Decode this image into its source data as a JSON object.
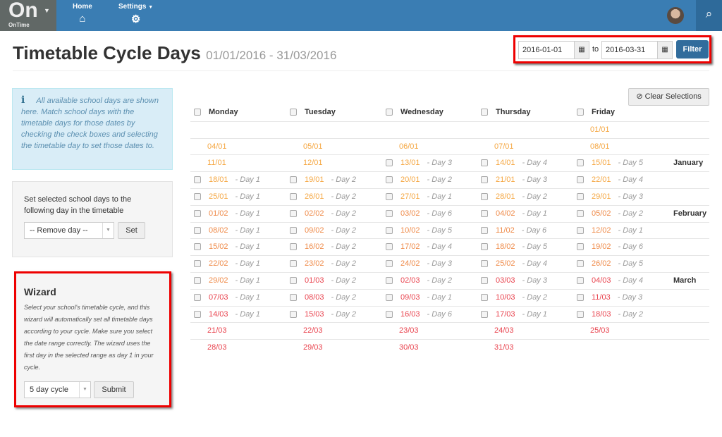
{
  "nav": {
    "brand": "On",
    "brand_sub": "OnTime",
    "home": "Home",
    "settings": "Settings",
    "home_icon": "home-icon",
    "settings_icon": "gear-icon",
    "search_icon": "search-icon"
  },
  "page": {
    "title": "Timetable Cycle Days",
    "subtitle": "01/01/2016 - 31/03/2016"
  },
  "filter": {
    "from": "2016-01-01",
    "to_label": "to",
    "to": "2016-03-31",
    "button": "Filter"
  },
  "info": {
    "text": "All available school days are shown here. Match school days with the timetable days for those dates by checking the check boxes and selecting the timetable day to set those dates to."
  },
  "set_panel": {
    "label": "Set selected school days to the following day in the timetable",
    "select_value": "-- Remove day --",
    "button": "Set"
  },
  "wizard": {
    "title": "Wizard",
    "text": "Select your school's timetable cycle, and this wizard will automatically set all timetable days according to your cycle. Make sure you select the date range correctly. The wizard uses the first day in the selected range as day 1 in your cycle.",
    "select_value": "5 day cycle",
    "button": "Submit"
  },
  "clear_button": "Clear Selections",
  "colors": {
    "01": "#f5a742",
    "02": "#ef8a48",
    "03": "#e9444f",
    "highlight": "#e00000",
    "nav": "#3a7db3"
  },
  "table": {
    "headers": [
      "Monday",
      "Tuesday",
      "Wednesday",
      "Thursday",
      "Friday"
    ],
    "rows": [
      {
        "month": "",
        "cells": [
          null,
          null,
          null,
          null,
          [
            "01/01",
            null
          ]
        ]
      },
      {
        "month": "",
        "cells": [
          [
            "04/01",
            null
          ],
          [
            "05/01",
            null
          ],
          [
            "06/01",
            null
          ],
          [
            "07/01",
            null
          ],
          [
            "08/01",
            null
          ]
        ]
      },
      {
        "month": "January",
        "cells": [
          [
            "11/01",
            null
          ],
          [
            "12/01",
            null
          ],
          [
            "13/01",
            "- Day 3"
          ],
          [
            "14/01",
            "- Day 4"
          ],
          [
            "15/01",
            "- Day 5"
          ]
        ]
      },
      {
        "month": "",
        "cells": [
          [
            "18/01",
            "- Day 1"
          ],
          [
            "19/01",
            "- Day 2"
          ],
          [
            "20/01",
            "- Day 2"
          ],
          [
            "21/01",
            "- Day 3"
          ],
          [
            "22/01",
            "- Day 4"
          ]
        ]
      },
      {
        "month": "",
        "cells": [
          [
            "25/01",
            "- Day 1"
          ],
          [
            "26/01",
            "- Day 2"
          ],
          [
            "27/01",
            "- Day 1"
          ],
          [
            "28/01",
            "- Day 2"
          ],
          [
            "29/01",
            "- Day 3"
          ]
        ]
      },
      {
        "month": "February",
        "cells": [
          [
            "01/02",
            "- Day 1"
          ],
          [
            "02/02",
            "- Day 2"
          ],
          [
            "03/02",
            "- Day 6"
          ],
          [
            "04/02",
            "- Day 1"
          ],
          [
            "05/02",
            "- Day 2"
          ]
        ]
      },
      {
        "month": "",
        "cells": [
          [
            "08/02",
            "- Day 1"
          ],
          [
            "09/02",
            "- Day 2"
          ],
          [
            "10/02",
            "- Day 5"
          ],
          [
            "11/02",
            "- Day 6"
          ],
          [
            "12/02",
            "- Day 1"
          ]
        ]
      },
      {
        "month": "",
        "cells": [
          [
            "15/02",
            "- Day 1"
          ],
          [
            "16/02",
            "- Day 2"
          ],
          [
            "17/02",
            "- Day 4"
          ],
          [
            "18/02",
            "- Day 5"
          ],
          [
            "19/02",
            "- Day 6"
          ]
        ]
      },
      {
        "month": "",
        "cells": [
          [
            "22/02",
            "- Day 1"
          ],
          [
            "23/02",
            "- Day 2"
          ],
          [
            "24/02",
            "- Day 3"
          ],
          [
            "25/02",
            "- Day 4"
          ],
          [
            "26/02",
            "- Day 5"
          ]
        ]
      },
      {
        "month": "March",
        "cells": [
          [
            "29/02",
            "- Day 1"
          ],
          [
            "01/03",
            "- Day 2"
          ],
          [
            "02/03",
            "- Day 2"
          ],
          [
            "03/03",
            "- Day 3"
          ],
          [
            "04/03",
            "- Day 4"
          ]
        ]
      },
      {
        "month": "",
        "cells": [
          [
            "07/03",
            "- Day 1"
          ],
          [
            "08/03",
            "- Day 2"
          ],
          [
            "09/03",
            "- Day 1"
          ],
          [
            "10/03",
            "- Day 2"
          ],
          [
            "11/03",
            "- Day 3"
          ]
        ]
      },
      {
        "month": "",
        "cells": [
          [
            "14/03",
            "- Day 1"
          ],
          [
            "15/03",
            "- Day 2"
          ],
          [
            "16/03",
            "- Day 6"
          ],
          [
            "17/03",
            "- Day 1"
          ],
          [
            "18/03",
            "- Day 2"
          ]
        ]
      },
      {
        "month": "",
        "cells": [
          [
            "21/03",
            null
          ],
          [
            "22/03",
            null
          ],
          [
            "23/03",
            null
          ],
          [
            "24/03",
            null
          ],
          [
            "25/03",
            null
          ]
        ]
      },
      {
        "month": "",
        "cells": [
          [
            "28/03",
            null
          ],
          [
            "29/03",
            null
          ],
          [
            "30/03",
            null
          ],
          [
            "31/03",
            null
          ],
          null
        ]
      }
    ]
  }
}
